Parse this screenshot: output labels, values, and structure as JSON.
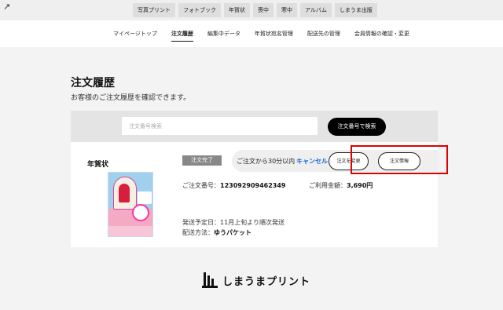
{
  "topbar": {
    "back_glyph": "↗",
    "categories": [
      "写真プリント",
      "フォトブック",
      "年賀状",
      "喪中",
      "寒中",
      "アルバム",
      "しまうま出版"
    ]
  },
  "subnav": {
    "items": [
      "マイページトップ",
      "注文履歴",
      "編集中データ",
      "年賀状宛名管理",
      "配送先の管理",
      "会員情報の確認・変更"
    ]
  },
  "page": {
    "title": "注文履歴",
    "subtitle": "お客様のご注文履歴を確認できます。"
  },
  "search": {
    "placeholder": "注文番号検索",
    "button_label": "注文番号で検索"
  },
  "order": {
    "product_name": "年賀状",
    "status": "注文完了",
    "cancel_note": "ご注文から30分以内",
    "cancel_link": "キャンセル",
    "change_button": "注文を変更",
    "info_button": "注文情報",
    "order_number_label": "ご注文番号：",
    "order_number": "123092909462349",
    "amount_label": "ご利用金額：",
    "amount": "3,690円",
    "ship_date_label": "発送予定日：",
    "ship_date": "11月上旬より順次発送",
    "ship_method_label": "配送方法：",
    "ship_method": "ゆうパケット"
  },
  "footer": {
    "brand": "しまうまプリント"
  },
  "colors": {
    "highlight": "#dd0000",
    "link": "#1769d3",
    "search_button": "#000000"
  }
}
